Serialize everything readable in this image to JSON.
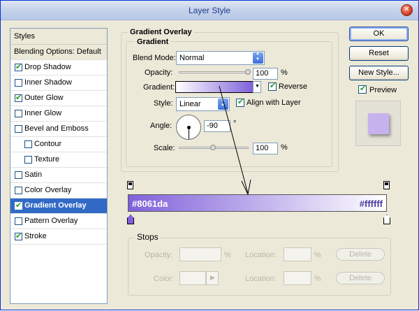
{
  "window": {
    "title": "Layer Style"
  },
  "left_panel": {
    "header": "Styles",
    "blending": "Blending Options: Default",
    "items": [
      {
        "label": "Drop Shadow",
        "checked": true
      },
      {
        "label": "Inner Shadow",
        "checked": false
      },
      {
        "label": "Outer Glow",
        "checked": true
      },
      {
        "label": "Inner Glow",
        "checked": false
      },
      {
        "label": "Bevel and Emboss",
        "checked": false
      },
      {
        "label": "Contour",
        "checked": false
      },
      {
        "label": "Texture",
        "checked": false
      },
      {
        "label": "Satin",
        "checked": false
      },
      {
        "label": "Color Overlay",
        "checked": false
      },
      {
        "label": "Gradient Overlay",
        "checked": true
      },
      {
        "label": "Pattern Overlay",
        "checked": false
      },
      {
        "label": "Stroke",
        "checked": true
      }
    ]
  },
  "gradient_overlay": {
    "section_title": "Gradient Overlay",
    "subsection_title": "Gradient",
    "blend_mode_label": "Blend Mode:",
    "blend_mode_value": "Normal",
    "opacity_label": "Opacity:",
    "opacity_value": "100",
    "opacity_fraction": 1.0,
    "percent_sign": "%",
    "gradient_label": "Gradient:",
    "reverse_label": "Reverse",
    "reverse_checked": true,
    "style_label": "Style:",
    "style_value": "Linear",
    "align_label": "Align with Layer",
    "align_checked": true,
    "angle_label": "Angle:",
    "angle_value": "-90",
    "degree_sign": "°",
    "scale_label": "Scale:",
    "scale_value": "100",
    "scale_fraction": 0.5
  },
  "buttons": {
    "ok": "OK",
    "reset": "Reset",
    "new_style": "New Style...",
    "preview_label": "Preview",
    "preview_checked": true
  },
  "gradient_editor": {
    "left_color_text": "#8061da",
    "right_color_text": "#ffffff",
    "left_color": "#8061da",
    "right_color": "#ffffff"
  },
  "stops": {
    "title": "Stops",
    "opacity_label": "Opacity:",
    "opacity_unit": "%",
    "location_label": "Location:",
    "location_unit": "%",
    "color_label": "Color:",
    "delete_label": "Delete"
  },
  "colors": {
    "accent_selected": "#316ac5",
    "gradient_start": "#8061da"
  }
}
